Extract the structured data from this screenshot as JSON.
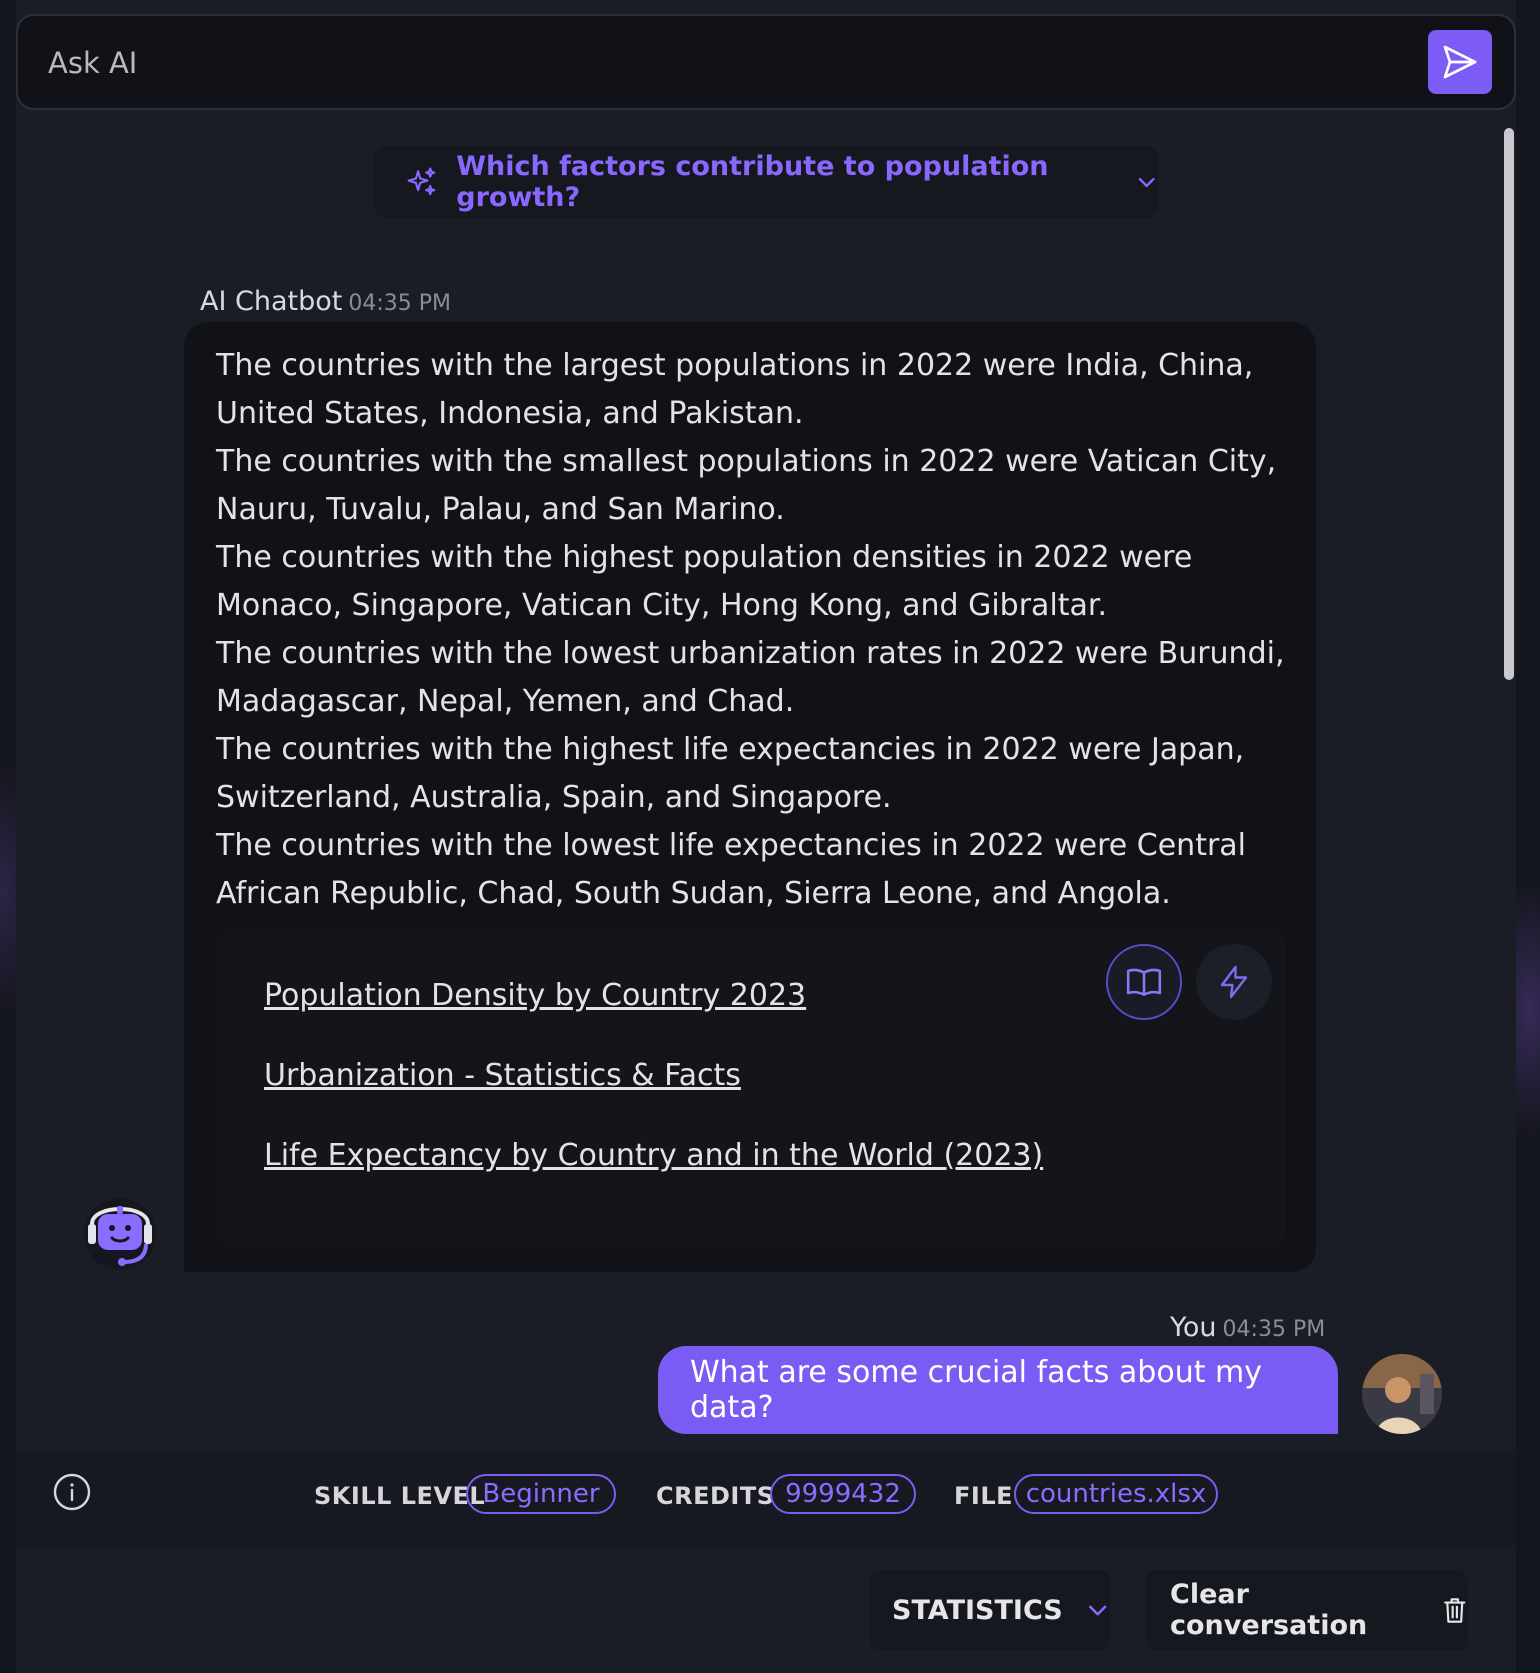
{
  "ask": {
    "placeholder": "Ask AI"
  },
  "suggestion": {
    "text": "Which factors contribute to population growth?"
  },
  "bot": {
    "name": "AI Chatbot",
    "time": "04:35 PM",
    "paragraphs": [
      "The countries with the largest populations in 2022 were India, China, United States, Indonesia, and Pakistan.",
      "The countries with the smallest populations in 2022 were Vatican City, Nauru, Tuvalu, Palau, and San Marino.",
      "The countries with the highest population densities in 2022 were Monaco, Singapore, Vatican City, Hong Kong, and Gibraltar.",
      "The countries with the lowest urbanization rates in 2022 were Burundi, Madagascar, Nepal, Yemen, and Chad.",
      "The countries with the highest life expectancies in 2022 were Japan, Switzerland, Australia, Spain, and Singapore.",
      "The countries with the lowest life expectancies in 2022 were Central African Republic, Chad, South Sudan, Sierra Leone, and Angola."
    ],
    "references": [
      "Population Density by Country 2023",
      "Urbanization - Statistics & Facts",
      "Life Expectancy by Country and in the World (2023)"
    ]
  },
  "user": {
    "name": "You",
    "time": "04:35 PM",
    "message": "What are some crucial facts about my data?"
  },
  "footer": {
    "skill_label": "SKILL LEVEL",
    "skill_value": "Beginner",
    "credits_label": "CREDITS",
    "credits_value": "9999432",
    "file_label": "FILE",
    "file_value": "countries.xlsx",
    "statistics_label": "STATISTICS",
    "clear_label": "Clear conversation"
  },
  "colors": {
    "accent": "#7c5cf5",
    "background": "#14161d",
    "bubble": "#111218"
  },
  "icons": [
    "send-icon",
    "sparkle-icon",
    "chevron-down-icon",
    "book-icon",
    "bolt-icon",
    "bot-avatar-icon",
    "info-icon",
    "trash-icon"
  ]
}
